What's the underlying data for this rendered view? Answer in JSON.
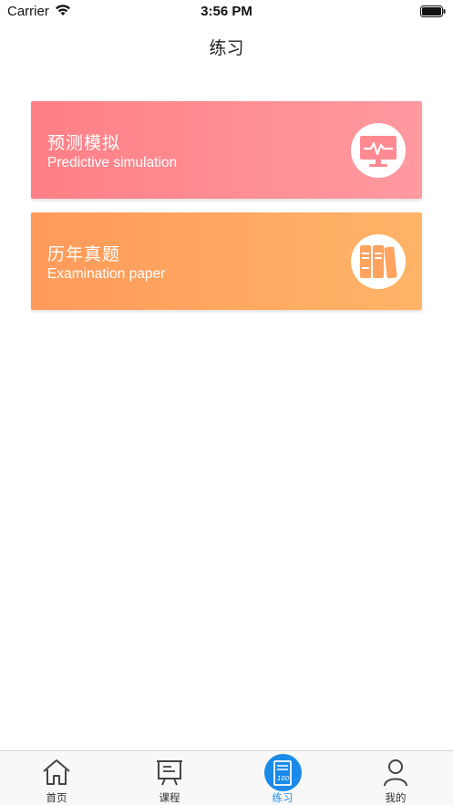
{
  "status_bar": {
    "carrier": "Carrier",
    "time": "3:56 PM"
  },
  "nav": {
    "title": "练习"
  },
  "cards": [
    {
      "title": "预测模拟",
      "subtitle": "Predictive simulation",
      "icon": "monitor-pulse-icon",
      "gradient": [
        "#ff7f86",
        "#ff9aa0"
      ]
    },
    {
      "title": "历年真题",
      "subtitle": "Examination paper",
      "icon": "books-icon",
      "gradient": [
        "#ff9a5a",
        "#ffb468"
      ]
    }
  ],
  "tabs": [
    {
      "label": "首页",
      "icon": "home-icon",
      "active": false
    },
    {
      "label": "课程",
      "icon": "course-board-icon",
      "active": false
    },
    {
      "label": "练习",
      "icon": "practice-paper-icon",
      "active": true
    },
    {
      "label": "我的",
      "icon": "user-icon",
      "active": false
    }
  ],
  "colors": {
    "accent": "#1a8be8",
    "tab_inactive": "#333333"
  }
}
